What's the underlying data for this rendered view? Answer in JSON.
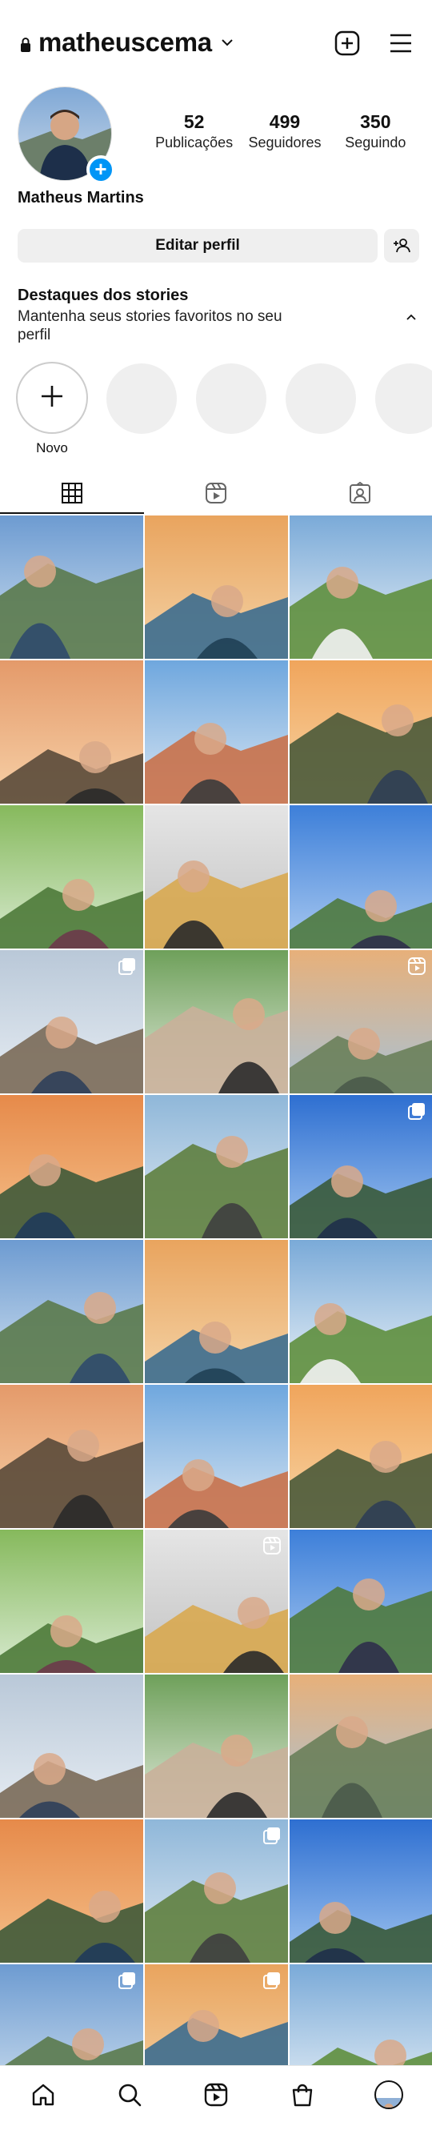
{
  "header": {
    "username": "matheuscema",
    "lock_icon": "lock-icon",
    "dropdown_icon": "chevron-down-icon",
    "create_icon": "plus-square-icon",
    "menu_icon": "hamburger-menu-icon"
  },
  "profile": {
    "full_name": "Matheus Martins",
    "stats": [
      {
        "value": "52",
        "label": "Publicações"
      },
      {
        "value": "499",
        "label": "Seguidores"
      },
      {
        "value": "350",
        "label": "Seguindo"
      }
    ],
    "edit_button": "Editar perfil",
    "discover_icon": "add-person-icon"
  },
  "highlights": {
    "title": "Destaques dos stories",
    "subtitle": "Mantenha seus stories favoritos no seu perfil",
    "new_label": "Novo"
  },
  "tabs": [
    {
      "icon": "grid-icon",
      "active": true
    },
    {
      "icon": "reels-icon",
      "active": false
    },
    {
      "icon": "tagged-icon",
      "active": false
    }
  ],
  "posts": [
    {
      "badge": null
    },
    {
      "badge": null
    },
    {
      "badge": null
    },
    {
      "badge": null
    },
    {
      "badge": null
    },
    {
      "badge": null
    },
    {
      "badge": null
    },
    {
      "badge": null
    },
    {
      "badge": null
    },
    {
      "badge": "carousel"
    },
    {
      "badge": null
    },
    {
      "badge": "reel"
    },
    {
      "badge": null
    },
    {
      "badge": null
    },
    {
      "badge": "carousel"
    },
    {
      "badge": null
    },
    {
      "badge": null
    },
    {
      "badge": null
    },
    {
      "badge": null
    },
    {
      "badge": null
    },
    {
      "badge": null
    },
    {
      "badge": null
    },
    {
      "badge": "reel"
    },
    {
      "badge": null
    },
    {
      "badge": null
    },
    {
      "badge": null
    },
    {
      "badge": null
    },
    {
      "badge": null
    },
    {
      "badge": "carousel"
    },
    {
      "badge": null
    },
    {
      "badge": "carousel"
    },
    {
      "badge": "carousel"
    },
    {
      "badge": null
    }
  ],
  "bottom_nav": [
    {
      "icon": "home-icon"
    },
    {
      "icon": "search-icon"
    },
    {
      "icon": "reels-icon"
    },
    {
      "icon": "shop-icon"
    },
    {
      "icon": "profile-avatar"
    }
  ]
}
